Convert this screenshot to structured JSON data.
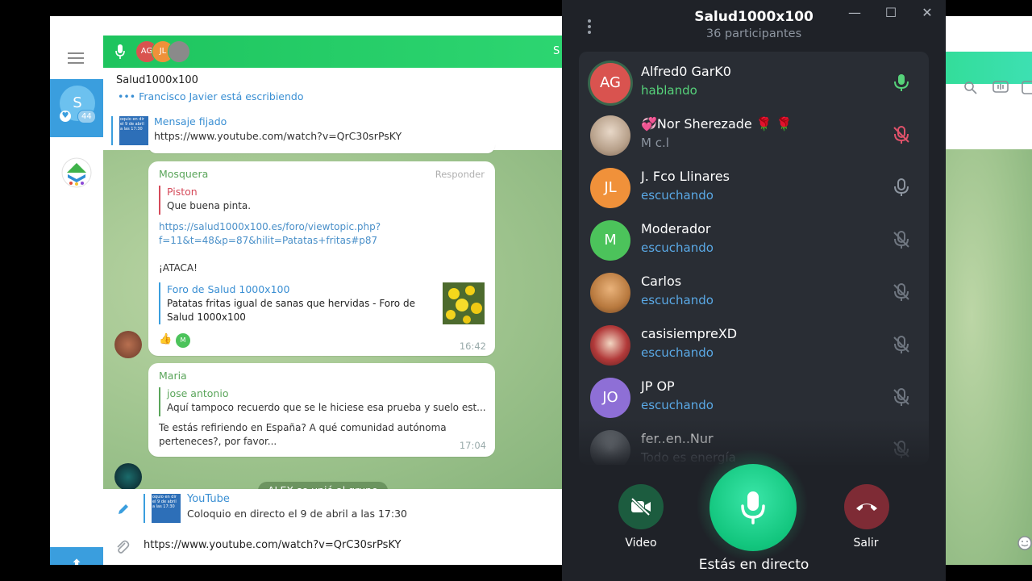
{
  "app": {
    "group_title": "Salud1000x100"
  },
  "folders": {
    "selected_avatar": "S",
    "unread_count": "44"
  },
  "chat": {
    "title": "Salud1000x100",
    "typing": "••• Francisco Javier está escribiendo",
    "vc_bar_avatars": [
      "AG",
      "JL"
    ],
    "vc_bar_right_letter": "S",
    "pinned": {
      "title": "Mensaje fijado",
      "url": "https://www.youtube.com/watch?v=QrC30srPsKY",
      "thumb_text": "oquio en dir el 9 de abril a las 17:30"
    },
    "messages": [
      {
        "sender": "Mosquera",
        "reply_action": "Responder",
        "reply_to": {
          "name": "Piston",
          "text": "Que buena pinta."
        },
        "link_line1": "https://salud1000x100.es/foro/viewtopic.php?",
        "link_line2": "f=11&t=48&p=87&hilit=Patatas+fritas#p87",
        "text": "¡ATACA!",
        "preview": {
          "site": "Foro de Salud 1000x100",
          "title_line1": "Patatas fritas igual de sanas que hervidas - Foro de",
          "title_line2": "Salud 1000x100"
        },
        "reactions": "👍",
        "reaction_avatar": "M",
        "time": "16:42"
      },
      {
        "sender": "Maria",
        "reply_to": {
          "name": "jose antonio",
          "text": "Aquí tampoco recuerdo que se le hiciese esa prueba y suelo est..."
        },
        "text_line1": "Te estás refiriendo en España? A qué comunidad autónoma",
        "text_line2": "perteneces?, por favor...",
        "time": "17:04"
      }
    ],
    "service_message": "ALEX se unió al grupo",
    "compose": {
      "edit_title": "YouTube",
      "edit_desc": "Coloquio en directo el 9 de abril a las 17:30",
      "thumb_text": "oquio en dir el 9 de abril a las 17:30",
      "input_value": "https://www.youtube.com/watch?v=QrC30srPsKY"
    }
  },
  "voice_chat": {
    "title": "Salud1000x100",
    "subtitle": "36 participantes",
    "participants": [
      {
        "name": "Alfred0 GarK0",
        "status": "hablando",
        "initials": "AG",
        "avatar_color": "#d9534f",
        "status_color": "#56d27a",
        "mic": "speaking"
      },
      {
        "name": "💞Nor Sherezade 🌹 🌹",
        "status": "M c.l",
        "initials": "",
        "avatar_color": "#c9b9a8",
        "status_color": "#8d95a0",
        "mic": "muted-red"
      },
      {
        "name": "J. Fco Llinares",
        "status": "escuchando",
        "initials": "JL",
        "avatar_color": "#f0913a",
        "status_color": "#5aa9e6",
        "mic": "on"
      },
      {
        "name": "Moderador",
        "status": "escuchando",
        "initials": "M",
        "avatar_color": "#4cc35b",
        "status_color": "#5aa9e6",
        "mic": "off"
      },
      {
        "name": "Carlos",
        "status": "escuchando",
        "initials": "",
        "avatar_color": "#c98b4e",
        "status_color": "#5aa9e6",
        "mic": "off"
      },
      {
        "name": "casisiempreXD",
        "status": "escuchando",
        "initials": "",
        "avatar_color": "#b23a3a",
        "status_color": "#5aa9e6",
        "mic": "off"
      },
      {
        "name": "JP OP",
        "status": "escuchando",
        "initials": "JO",
        "avatar_color": "#8e6fd6",
        "status_color": "#5aa9e6",
        "mic": "off"
      },
      {
        "name": "fer..en..Nur",
        "status": "Todo es energía",
        "initials": "",
        "avatar_color": "#6d6f74",
        "status_color": "#8d95a0",
        "mic": "off"
      }
    ],
    "buttons": {
      "video": "Video",
      "leave": "Salir"
    },
    "live_label": "Estás en directo"
  }
}
